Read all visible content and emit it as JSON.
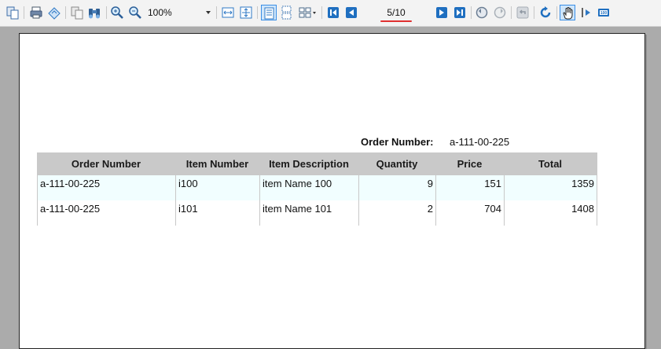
{
  "toolbar": {
    "zoom_value": "100%",
    "page_indicator": "5/10"
  },
  "report": {
    "order_number_label": "Order Number:",
    "order_number_value": "a-111-00-225",
    "columns": [
      "Order Number",
      "Item Number",
      "Item Description",
      "Quantity",
      "Price",
      "Total"
    ],
    "rows": [
      [
        "a-111-00-225",
        "i100",
        "item Name 100",
        "9",
        "151",
        "1359"
      ],
      [
        "a-111-00-225",
        "i101",
        "item Name 101",
        "2",
        "704",
        "1408"
      ]
    ]
  },
  "colors": {
    "header_bg": "#c9c9c9",
    "row_highlight": "#f1feff",
    "accent": "#3a8ee6"
  }
}
